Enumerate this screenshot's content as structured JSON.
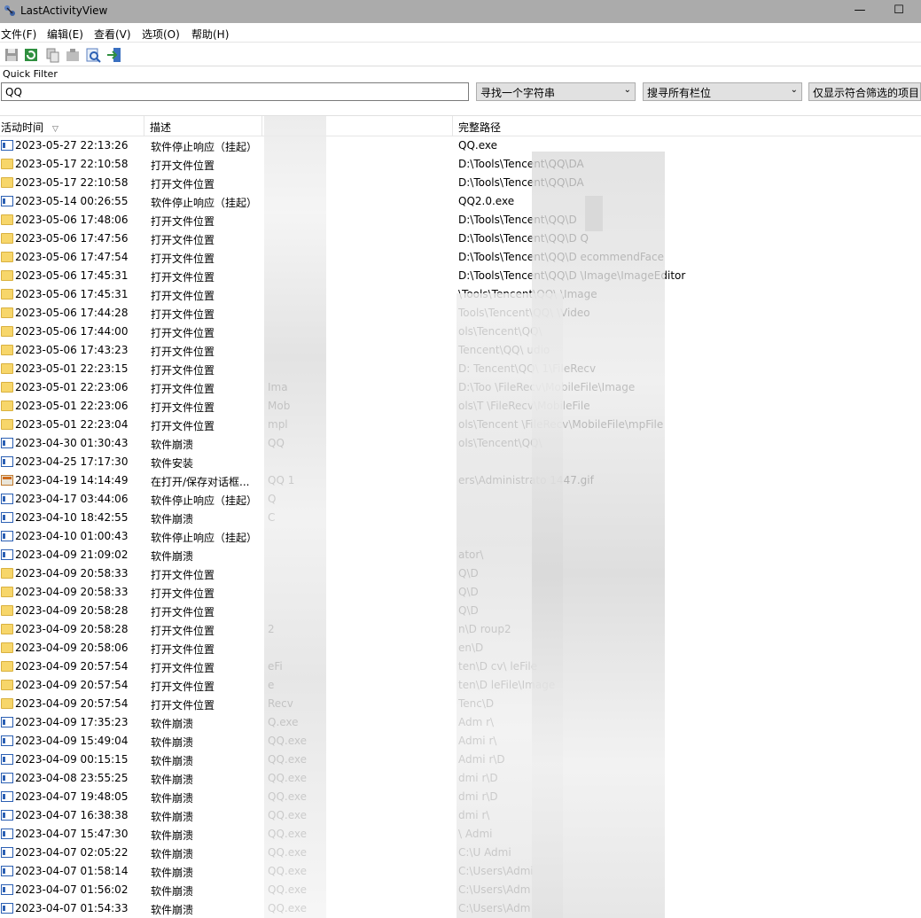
{
  "window": {
    "title": "LastActivityView"
  },
  "titlebar_icons": [
    "minimize-icon",
    "maximize-icon"
  ],
  "menu": [
    "文件(F)",
    "编辑(E)",
    "查看(V)",
    "选项(O)",
    "帮助(H)"
  ],
  "toolbar_icons": [
    "save-icon",
    "refresh-icon",
    "copy-icon",
    "properties-icon",
    "find-icon",
    "exit-icon"
  ],
  "quick_filter": {
    "label": "Quick Filter",
    "value": "QQ",
    "mode": "寻找一个字符串",
    "scope": "搜寻所有栏位",
    "button": "仅显示符合筛选的项目"
  },
  "columns": [
    "活动时间",
    "描述",
    "",
    "完整路径"
  ],
  "rows": [
    {
      "icon": "app",
      "time": "2023-05-27 22:13:26",
      "desc": "软件停止响应（挂起）",
      "name": "",
      "path": "QQ.exe"
    },
    {
      "icon": "folder",
      "time": "2023-05-17 22:10:58",
      "desc": "打开文件位置",
      "name": "",
      "path": "D:\\Tools\\Tencent\\QQ\\DA"
    },
    {
      "icon": "folder",
      "time": "2023-05-17 22:10:58",
      "desc": "打开文件位置",
      "name": "",
      "path": "D:\\Tools\\Tencent\\QQ\\DA"
    },
    {
      "icon": "app",
      "time": "2023-05-14 00:26:55",
      "desc": "软件停止响应（挂起）",
      "name": "",
      "path": "QQ2.0.exe"
    },
    {
      "icon": "folder",
      "time": "2023-05-06 17:48:06",
      "desc": "打开文件位置",
      "name": "",
      "path": "D:\\Tools\\Tencent\\QQ\\D"
    },
    {
      "icon": "folder",
      "time": "2023-05-06 17:47:56",
      "desc": "打开文件位置",
      "name": "",
      "path": "D:\\Tools\\Tencent\\QQ\\D                    Q"
    },
    {
      "icon": "folder",
      "time": "2023-05-06 17:47:54",
      "desc": "打开文件位置",
      "name": "",
      "path": "D:\\Tools\\Tencent\\QQ\\D                  ecommendFace"
    },
    {
      "icon": "folder",
      "time": "2023-05-06 17:45:31",
      "desc": "打开文件位置",
      "name": "",
      "path": "D:\\Tools\\Tencent\\QQ\\D                  \\Image\\ImageEditor"
    },
    {
      "icon": "folder",
      "time": "2023-05-06 17:45:31",
      "desc": "打开文件位置",
      "name": "",
      "path": "\\Tools\\Tencent\\QQ\\                   \\Image"
    },
    {
      "icon": "folder",
      "time": "2023-05-06 17:44:28",
      "desc": "打开文件位置",
      "name": "",
      "path": "Tools\\Tencent\\QQ\\                    \\Video"
    },
    {
      "icon": "folder",
      "time": "2023-05-06 17:44:00",
      "desc": "打开文件位置",
      "name": "",
      "path": "ols\\Tencent\\QQ\\"
    },
    {
      "icon": "folder",
      "time": "2023-05-06 17:43:23",
      "desc": "打开文件位置",
      "name": "",
      "path": "Tencent\\QQ\\               udio"
    },
    {
      "icon": "folder",
      "time": "2023-05-01 22:23:15",
      "desc": "打开文件位置",
      "name": "",
      "path": "D:                 Tencent\\QQ\\                1\\FileRecv"
    },
    {
      "icon": "folder",
      "time": "2023-05-01 22:23:06",
      "desc": "打开文件位置",
      "name": "Ima",
      "path": "D:\\Too                 \\FileRecv\\MobileFile\\Image"
    },
    {
      "icon": "folder",
      "time": "2023-05-01 22:23:06",
      "desc": "打开文件位置",
      "name": "Mob",
      "path": "ols\\T                        \\FileRecv\\MobileFile"
    },
    {
      "icon": "folder",
      "time": "2023-05-01 22:23:04",
      "desc": "打开文件位置",
      "name": "mpl",
      "path": "ols\\Tencent                    \\FileRecv\\MobileFile\\mpFile"
    },
    {
      "icon": "app",
      "time": "2023-04-30 01:30:43",
      "desc": "软件崩溃",
      "name": "QQ",
      "path": "ols\\Tencent\\QQ\\"
    },
    {
      "icon": "app",
      "time": "2023-04-25 17:17:30",
      "desc": "软件安装",
      "name": "",
      "path": ""
    },
    {
      "icon": "dialog",
      "time": "2023-04-19 14:14:49",
      "desc": "在打开/保存对话框...",
      "name": "QQ                  1",
      "path": "ers\\Administrato                            1447.gif"
    },
    {
      "icon": "app",
      "time": "2023-04-17 03:44:06",
      "desc": "软件停止响应（挂起）",
      "name": "Q",
      "path": ""
    },
    {
      "icon": "app",
      "time": "2023-04-10 18:42:55",
      "desc": "软件崩溃",
      "name": "C",
      "path": ""
    },
    {
      "icon": "app",
      "time": "2023-04-10 01:00:43",
      "desc": "软件停止响应（挂起）",
      "name": "",
      "path": ""
    },
    {
      "icon": "app",
      "time": "2023-04-09 21:09:02",
      "desc": "软件崩溃",
      "name": "",
      "path": "ator\\"
    },
    {
      "icon": "folder",
      "time": "2023-04-09 20:58:33",
      "desc": "打开文件位置",
      "name": "",
      "path": "Q\\D"
    },
    {
      "icon": "folder",
      "time": "2023-04-09 20:58:33",
      "desc": "打开文件位置",
      "name": "",
      "path": "Q\\D"
    },
    {
      "icon": "folder",
      "time": "2023-04-09 20:58:28",
      "desc": "打开文件位置",
      "name": "",
      "path": "Q\\D"
    },
    {
      "icon": "folder",
      "time": "2023-04-09 20:58:28",
      "desc": "打开文件位置",
      "name": "2",
      "path": "n\\D                    roup2"
    },
    {
      "icon": "folder",
      "time": "2023-04-09 20:58:06",
      "desc": "打开文件位置",
      "name": "",
      "path": "en\\D"
    },
    {
      "icon": "folder",
      "time": "2023-04-09 20:57:54",
      "desc": "打开文件位置",
      "name": "eFi",
      "path": "ten\\D                  cv\\    leFile"
    },
    {
      "icon": "folder",
      "time": "2023-04-09 20:57:54",
      "desc": "打开文件位置",
      "name": "e",
      "path": "ten\\D                   leFile\\Image"
    },
    {
      "icon": "folder",
      "time": "2023-04-09 20:57:54",
      "desc": "打开文件位置",
      "name": "Recv",
      "path": "Tenc\\D"
    },
    {
      "icon": "app",
      "time": "2023-04-09 17:35:23",
      "desc": "软件崩溃",
      "name": "Q.exe",
      "path": "Adm     r\\"
    },
    {
      "icon": "app",
      "time": "2023-04-09 15:49:04",
      "desc": "软件崩溃",
      "name": "QQ.exe",
      "path": "Admi     r\\"
    },
    {
      "icon": "app",
      "time": "2023-04-09 00:15:15",
      "desc": "软件崩溃",
      "name": "QQ.exe",
      "path": "Admi     r\\D"
    },
    {
      "icon": "app",
      "time": "2023-04-08 23:55:25",
      "desc": "软件崩溃",
      "name": "QQ.exe",
      "path": "dmi     r\\D"
    },
    {
      "icon": "app",
      "time": "2023-04-07 19:48:05",
      "desc": "软件崩溃",
      "name": "QQ.exe",
      "path": "dmi     r\\D"
    },
    {
      "icon": "app",
      "time": "2023-04-07 16:38:38",
      "desc": "软件崩溃",
      "name": "QQ.exe",
      "path": "dmi     r\\"
    },
    {
      "icon": "app",
      "time": "2023-04-07 15:47:30",
      "desc": "软件崩溃",
      "name": "QQ.exe",
      "path": "\\     Admi"
    },
    {
      "icon": "app",
      "time": "2023-04-07 02:05:22",
      "desc": "软件崩溃",
      "name": "QQ.exe",
      "path": "C:\\U      Admi"
    },
    {
      "icon": "app",
      "time": "2023-04-07 01:58:14",
      "desc": "软件崩溃",
      "name": "QQ.exe",
      "path": "C:\\Users\\Admi"
    },
    {
      "icon": "app",
      "time": "2023-04-07 01:56:02",
      "desc": "软件崩溃",
      "name": "QQ.exe",
      "path": "C:\\Users\\Adm"
    },
    {
      "icon": "app",
      "time": "2023-04-07 01:54:33",
      "desc": "软件崩溃",
      "name": "QQ.exe",
      "path": "C:\\Users\\Adm"
    }
  ]
}
